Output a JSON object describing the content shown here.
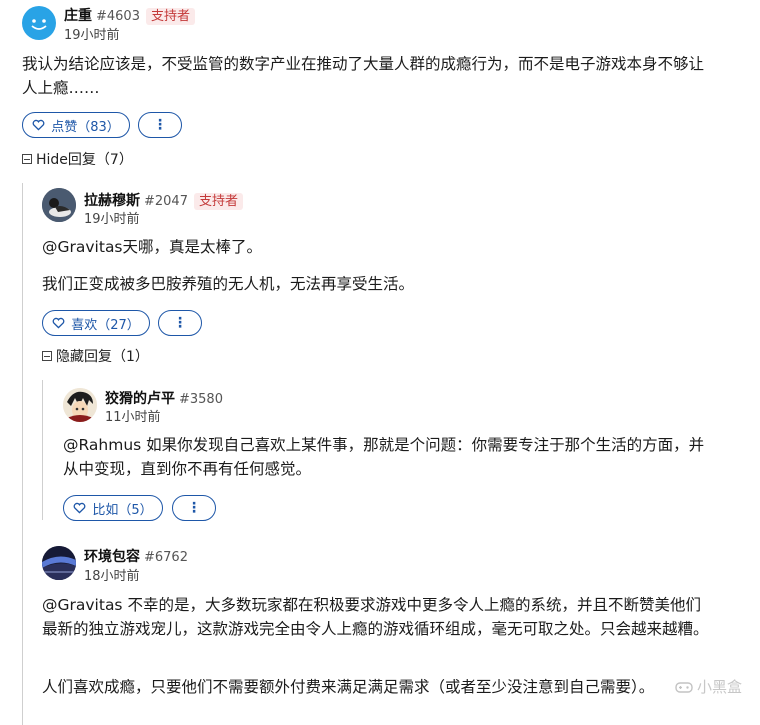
{
  "comments": [
    {
      "author": "庄重",
      "number": "#4603",
      "badge": "支持者",
      "time": "19小时前",
      "paragraphs": [
        "我认为结论应该是，不受监管的数字产业在推动了大量人群的成瘾行为，而不是电子游戏本身不够让人上瘾……"
      ],
      "like_label": "点赞（83）",
      "more_label": "⋮",
      "toggle_label": "Hide回复（7）"
    },
    {
      "author": "拉赫穆斯",
      "number": "#2047",
      "badge": "支持者",
      "time": "19小时前",
      "paragraphs": [
        "@Gravitas天哪，真是太棒了。",
        "我们正变成被多巴胺养殖的无人机，无法再享受生活。"
      ],
      "like_label": "喜欢（27）",
      "more_label": "⋮",
      "toggle_label": "隐藏回复（1）"
    },
    {
      "author": "狡猾的卢平",
      "number": "#3580",
      "time": "11小时前",
      "paragraphs": [
        "@Rahmus 如果你发现自己喜欢上某件事，那就是个问题：你需要专注于那个生活的方面，并从中变现，直到你不再有任何感觉。"
      ],
      "like_label": "比如（5）",
      "more_label": "⋮"
    },
    {
      "author": "环境包容",
      "number": "#6762",
      "time": "18小时前",
      "paragraphs": [
        "@Gravitas 不幸的是，大多数玩家都在积极要求游戏中更多令人上瘾的系统，并且不断赞美他们最新的独立游戏宠儿，这款游戏完全由令人上瘾的游戏循环组成，毫无可取之处。只会越来越糟。",
        "人们喜欢成瘾，只要他们不需要额外付费来满足满足需求（或者至少没注意到自己需要）。"
      ]
    }
  ],
  "watermark": "小黑盒",
  "colors": {
    "accent": "#1e57a8",
    "badge_text": "#c43a3a",
    "badge_bg": "#fbeaea"
  }
}
